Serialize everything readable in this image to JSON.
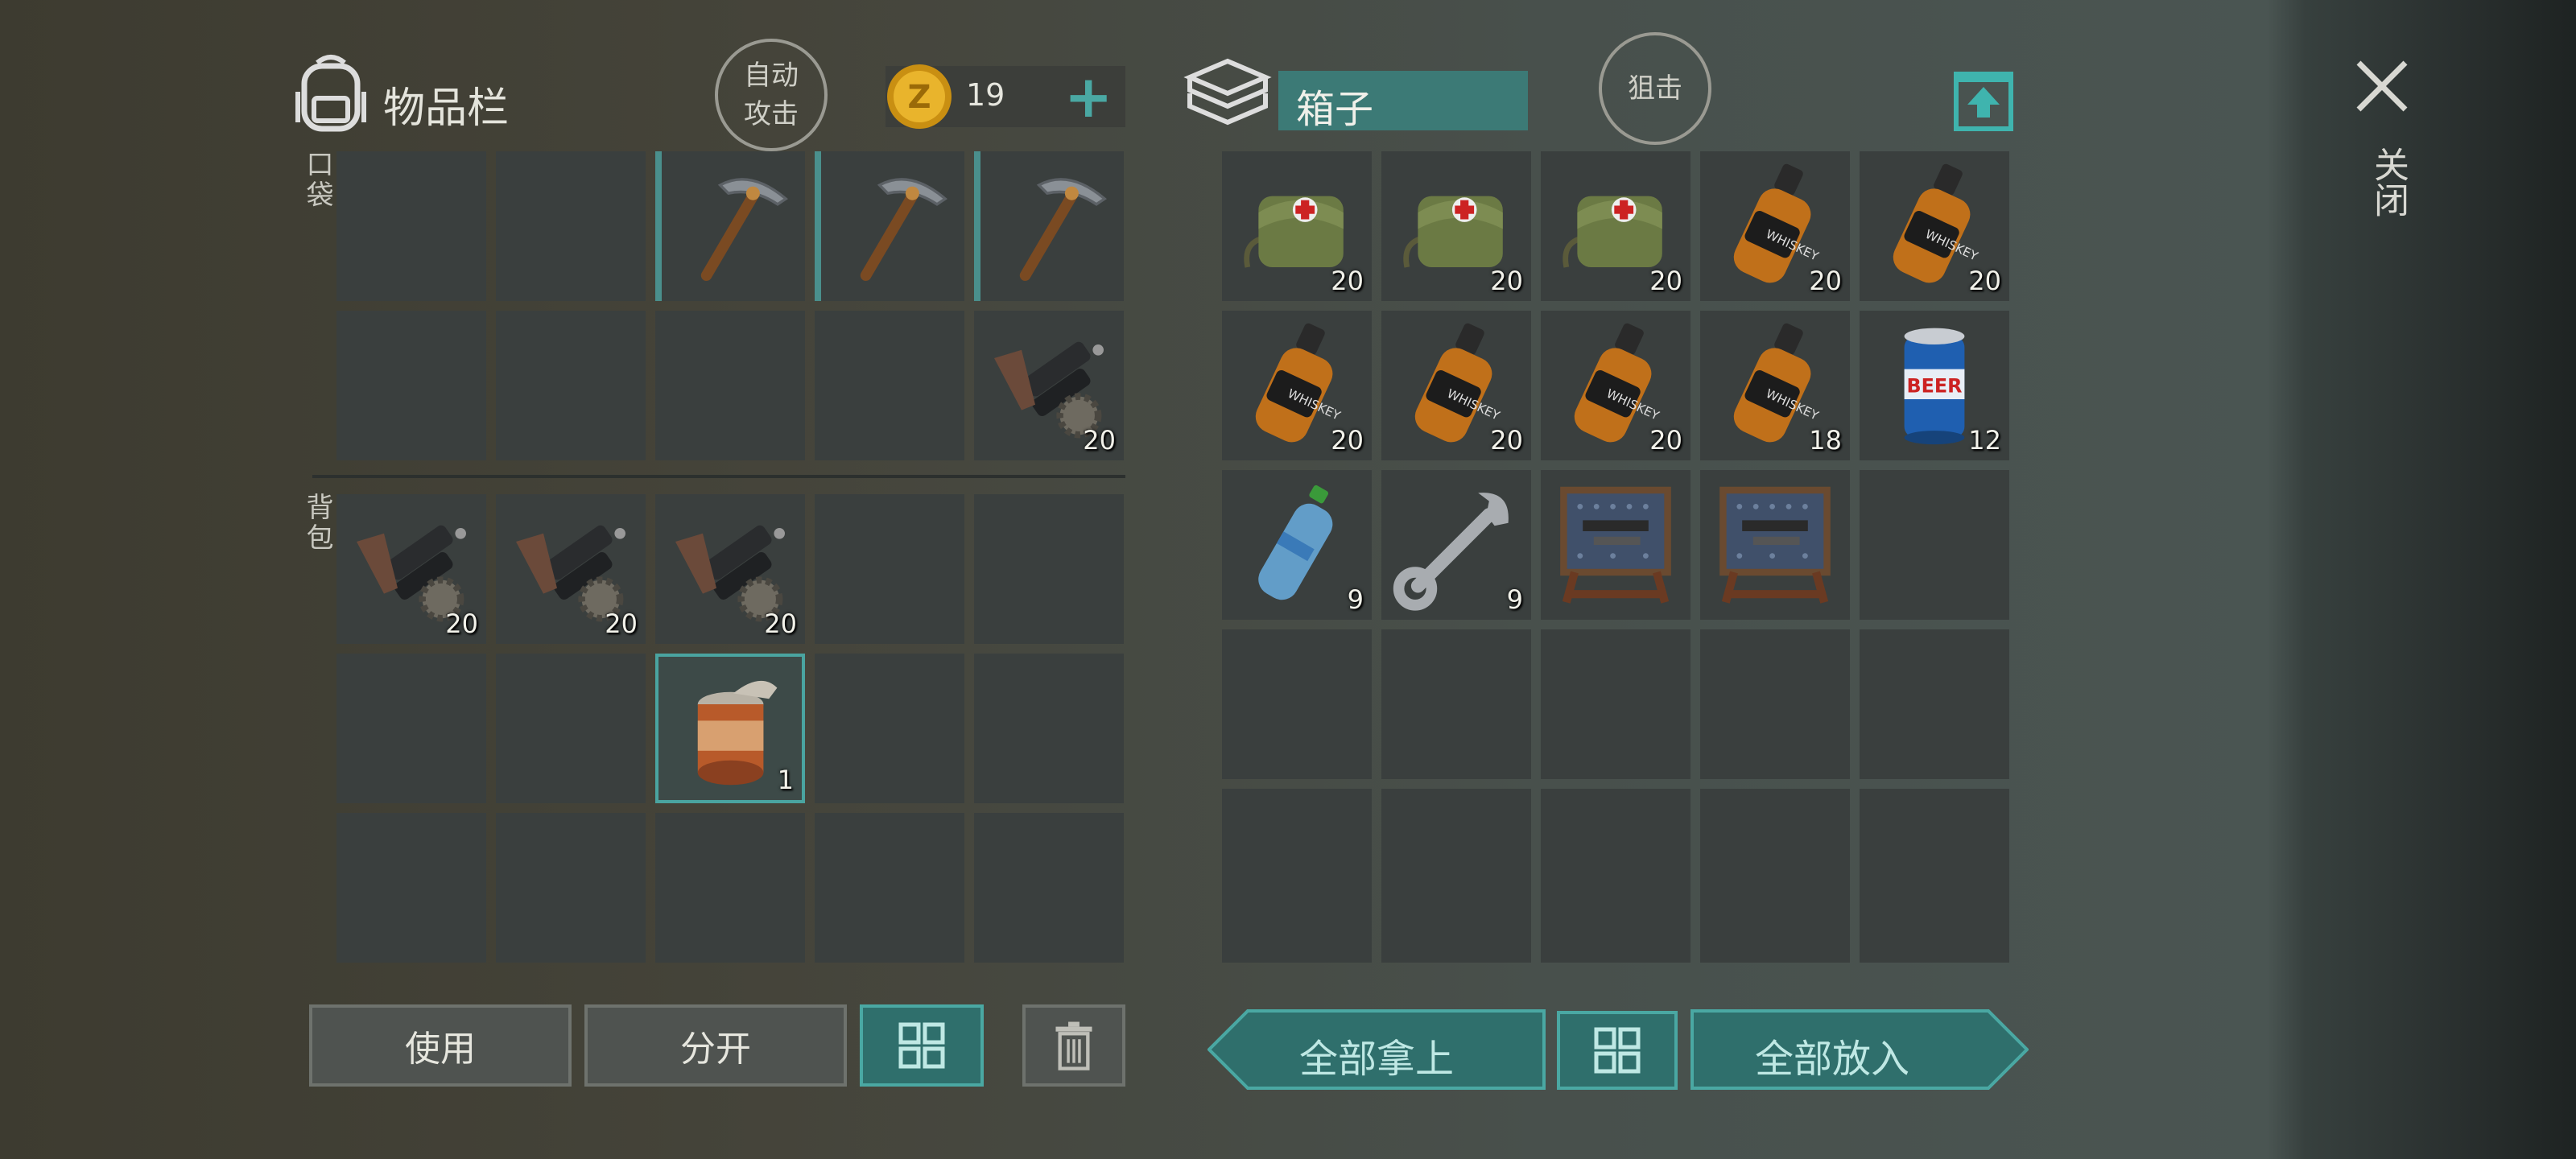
{
  "inventory": {
    "title": "物品栏",
    "auto_attack": "自动\n攻击",
    "coin_value": "19",
    "add_symbol": "+",
    "pocket_label": "口袋",
    "backpack_label": "背包",
    "pocket_slots": [
      {
        "item": "",
        "qty": ""
      },
      {
        "item": "",
        "qty": ""
      },
      {
        "item": "pickaxe",
        "qty": ""
      },
      {
        "item": "pickaxe",
        "qty": ""
      },
      {
        "item": "pickaxe",
        "qty": ""
      },
      {
        "item": "",
        "qty": ""
      },
      {
        "item": "",
        "qty": ""
      },
      {
        "item": "",
        "qty": ""
      },
      {
        "item": "",
        "qty": ""
      },
      {
        "item": "rifle-parts",
        "qty": "20"
      }
    ],
    "backpack_slots": [
      {
        "item": "rifle-parts",
        "qty": "20"
      },
      {
        "item": "rifle-parts",
        "qty": "20"
      },
      {
        "item": "rifle-parts",
        "qty": "20"
      },
      {
        "item": "",
        "qty": ""
      },
      {
        "item": "",
        "qty": ""
      },
      {
        "item": "",
        "qty": ""
      },
      {
        "item": "",
        "qty": ""
      },
      {
        "item": "tin-can",
        "qty": "1"
      },
      {
        "item": "",
        "qty": ""
      },
      {
        "item": "",
        "qty": ""
      },
      {
        "item": "",
        "qty": ""
      },
      {
        "item": "",
        "qty": ""
      },
      {
        "item": "",
        "qty": ""
      },
      {
        "item": "",
        "qty": ""
      },
      {
        "item": "",
        "qty": ""
      }
    ],
    "use_label": "使用",
    "split_label": "分开"
  },
  "box": {
    "title": "箱子",
    "snipe_label": "狙击",
    "slots": [
      {
        "item": "medkit-bag",
        "qty": "20"
      },
      {
        "item": "medkit-bag",
        "qty": "20"
      },
      {
        "item": "medkit-bag",
        "qty": "20"
      },
      {
        "item": "whiskey",
        "qty": "20"
      },
      {
        "item": "whiskey",
        "qty": "20"
      },
      {
        "item": "whiskey",
        "qty": "20"
      },
      {
        "item": "whiskey",
        "qty": "20"
      },
      {
        "item": "whiskey",
        "qty": "20"
      },
      {
        "item": "whiskey",
        "qty": "18"
      },
      {
        "item": "beer-can",
        "qty": "12"
      },
      {
        "item": "water-bottle",
        "qty": "9"
      },
      {
        "item": "wrench",
        "qty": "9"
      },
      {
        "item": "workbench",
        "qty": ""
      },
      {
        "item": "workbench",
        "qty": ""
      },
      {
        "item": "",
        "qty": ""
      },
      {
        "item": "",
        "qty": ""
      },
      {
        "item": "",
        "qty": ""
      },
      {
        "item": "",
        "qty": ""
      },
      {
        "item": "",
        "qty": ""
      },
      {
        "item": "",
        "qty": ""
      },
      {
        "item": "",
        "qty": ""
      },
      {
        "item": "",
        "qty": ""
      },
      {
        "item": "",
        "qty": ""
      },
      {
        "item": "",
        "qty": ""
      },
      {
        "item": "",
        "qty": ""
      }
    ],
    "take_all_label": "全部拿上",
    "put_all_label": "全部放入"
  },
  "close_label": "关闭",
  "colors": {
    "accent": "#4aa8a3",
    "slot": "#3a3f3e",
    "coin": "#e0a81e"
  }
}
